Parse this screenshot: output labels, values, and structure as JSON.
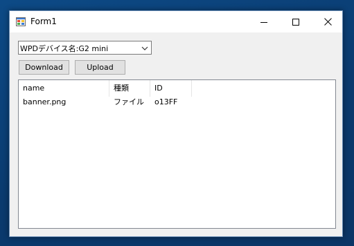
{
  "window": {
    "title": "Form1",
    "controls": {
      "minimize_icon": "minimize-icon",
      "maximize_icon": "maximize-icon",
      "close_icon": "close-icon"
    }
  },
  "device_combo": {
    "selected": "WPDデバイス名:G2 mini"
  },
  "buttons": {
    "download_label": "Download",
    "upload_label": "Upload"
  },
  "listview": {
    "columns": [
      "name",
      "種類",
      "ID"
    ],
    "rows": [
      [
        "banner.png",
        "ファイル",
        "o13FF"
      ]
    ]
  },
  "colors": {
    "desktop": "#0a3a6e",
    "window_bg": "#f0f0f0",
    "titlebar_bg": "#ffffff",
    "button_bg": "#e1e1e1"
  }
}
